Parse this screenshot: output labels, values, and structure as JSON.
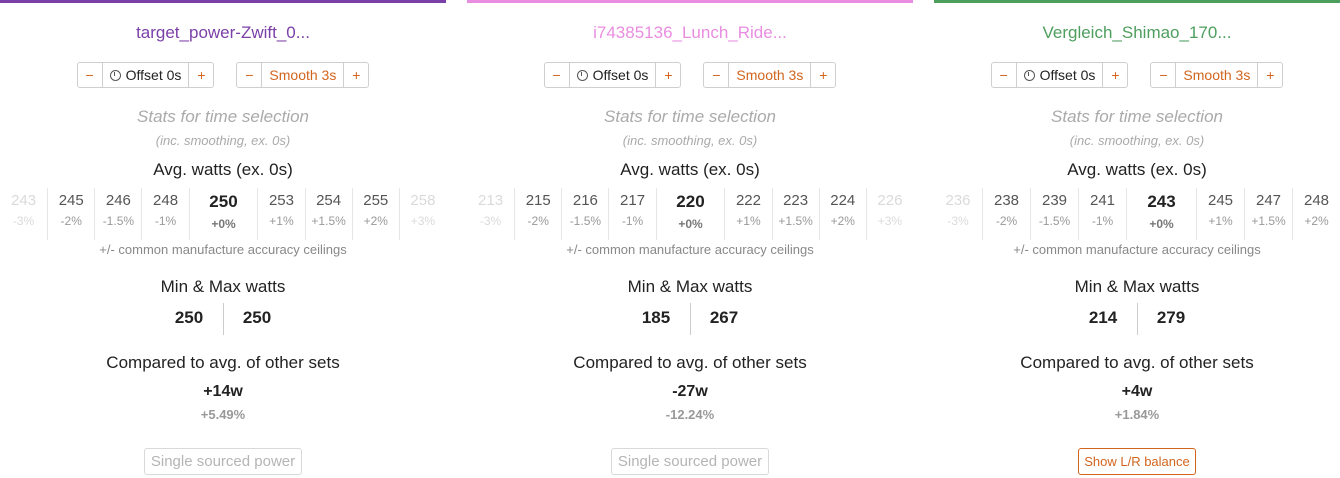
{
  "panels": [
    {
      "title": "target_power-Zwift_0...",
      "color": "#7b3fa8",
      "offset_label": "Offset 0s",
      "smooth_label": "Smooth 3s",
      "minus": "−",
      "plus": "+",
      "stats_title": "Stats for time selection",
      "stats_sub": "(inc. smoothing, ex. 0s)",
      "avg_label": "Avg. watts (ex. 0s)",
      "watts": [
        {
          "v": "243",
          "p": "-3%"
        },
        {
          "v": "245",
          "p": "-2%"
        },
        {
          "v": "246",
          "p": "-1.5%"
        },
        {
          "v": "248",
          "p": "-1%"
        },
        {
          "v": "250",
          "p": "+0%"
        },
        {
          "v": "253",
          "p": "+1%"
        },
        {
          "v": "254",
          "p": "+1.5%"
        },
        {
          "v": "255",
          "p": "+2%"
        },
        {
          "v": "258",
          "p": "+3%"
        }
      ],
      "accuracy": "+/- common manufacture accuracy ceilings",
      "minmax_label": "Min & Max watts",
      "min": "250",
      "max": "250",
      "compare_label": "Compared to avg. of other sets",
      "diff_w": "+14w",
      "diff_p": "+5.49%",
      "button": "Single sourced power",
      "button_active": false
    },
    {
      "title": "i74385136_Lunch_Ride...",
      "color": "#e98de0",
      "offset_label": "Offset 0s",
      "smooth_label": "Smooth 3s",
      "minus": "−",
      "plus": "+",
      "stats_title": "Stats for time selection",
      "stats_sub": "(inc. smoothing, ex. 0s)",
      "avg_label": "Avg. watts (ex. 0s)",
      "watts": [
        {
          "v": "213",
          "p": "-3%"
        },
        {
          "v": "215",
          "p": "-2%"
        },
        {
          "v": "216",
          "p": "-1.5%"
        },
        {
          "v": "217",
          "p": "-1%"
        },
        {
          "v": "220",
          "p": "+0%"
        },
        {
          "v": "222",
          "p": "+1%"
        },
        {
          "v": "223",
          "p": "+1.5%"
        },
        {
          "v": "224",
          "p": "+2%"
        },
        {
          "v": "226",
          "p": "+3%"
        }
      ],
      "accuracy": "+/- common manufacture accuracy ceilings",
      "minmax_label": "Min & Max watts",
      "min": "185",
      "max": "267",
      "compare_label": "Compared to avg. of other sets",
      "diff_w": "-27w",
      "diff_p": "-12.24%",
      "button": "Single sourced power",
      "button_active": false
    },
    {
      "title": "Vergleich_Shimao_170...",
      "color": "#4e9e5e",
      "offset_label": "Offset 0s",
      "smooth_label": "Smooth 3s",
      "minus": "−",
      "plus": "+",
      "stats_title": "Stats for time selection",
      "stats_sub": "(inc. smoothing, ex. 0s)",
      "avg_label": "Avg. watts (ex. 0s)",
      "watts": [
        {
          "v": "236",
          "p": "-3%"
        },
        {
          "v": "238",
          "p": "-2%"
        },
        {
          "v": "239",
          "p": "-1.5%"
        },
        {
          "v": "241",
          "p": "-1%"
        },
        {
          "v": "243",
          "p": "+0%"
        },
        {
          "v": "245",
          "p": "+1%"
        },
        {
          "v": "247",
          "p": "+1.5%"
        },
        {
          "v": "248",
          "p": "+2%"
        }
      ],
      "accuracy": "+/- common manufacture accuracy ceilings",
      "minmax_label": "Min & Max watts",
      "min": "214",
      "max": "279",
      "compare_label": "Compared to avg. of other sets",
      "diff_w": "+4w",
      "diff_p": "+1.84%",
      "button": "Show L/R balance",
      "button_active": true
    }
  ]
}
